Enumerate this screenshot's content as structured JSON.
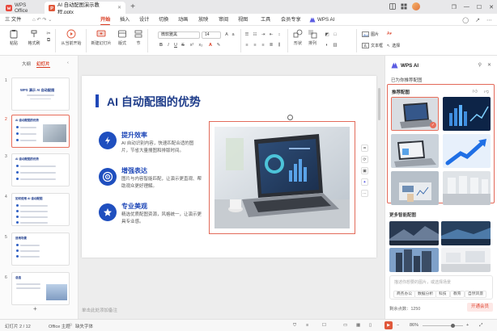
{
  "titlebar": {
    "tabs": [
      {
        "label": "WPS Office"
      },
      {
        "label": "AI 自动配图演示教程.pptx"
      }
    ],
    "colors": {
      "brand": "#d9381e",
      "wps": "#e8463a",
      "ppt": "#e0583b"
    }
  },
  "menubar": {
    "file_label": "三 文件",
    "items": [
      "开始",
      "插入",
      "设计",
      "切换",
      "动画",
      "放映",
      "审阅",
      "视图",
      "工具",
      "会员专享"
    ],
    "wps_ai": "WPS AI",
    "active_index": 0
  },
  "ribbon": {
    "paste": "粘贴",
    "format_painter": "格式刷",
    "from_current": "从当前开始",
    "new_slide": "新建幻灯片",
    "layout": "版式",
    "section": "节",
    "font_name": "微软雅黑",
    "font_size": "14",
    "shape": "形状",
    "arrange": "排列",
    "picture": "图片",
    "textbox": "文本框",
    "select": "选择"
  },
  "leftpanel": {
    "tabs": [
      "大纲",
      "幻灯片"
    ],
    "active_tab": 1,
    "slides": [
      {
        "num": "1",
        "title": "WPS 演示 AI 自动配图"
      },
      {
        "num": "2",
        "title": "AI 自动配图的优势"
      },
      {
        "num": "3",
        "title": "AI 自动配图的优势"
      },
      {
        "num": "4",
        "title": "如何使用 AI 自动配图"
      },
      {
        "num": "5",
        "title": "适用场景"
      },
      {
        "num": "6",
        "title": "总结"
      }
    ],
    "add_symbol": "+"
  },
  "slide": {
    "title": "AI 自动配图的优势",
    "features": [
      {
        "title": "提升效率",
        "desc": "AI 自动识别内容，快速匹配合适的图片，节省大量搜图和排版时间。"
      },
      {
        "title": "增强表达",
        "desc": "图片与内容智能匹配，让演示更直观、帮助观众更好理解。"
      },
      {
        "title": "专业美观",
        "desc": "精选优质配图资源，风格统一，让演示更具专业感。"
      }
    ],
    "accent": "#1f48b8"
  },
  "notes_placeholder": "单击此处添加备注",
  "ai_panel": {
    "title": "WPS AI",
    "subtitle": "已为你推荐配图",
    "rec_title": "推荐配图",
    "more_title": "更多智能配图",
    "prompt_placeholder": "描述你想要的图片，或选择场景",
    "chips": [
      "商务办公",
      "数据分析",
      "科技",
      "教育",
      "自然风景"
    ],
    "points": "剩余点数：1250",
    "generate": "开通会员"
  },
  "statusbar": {
    "slide_count": "幻灯片 2 / 12",
    "theme": "Office 主题",
    "missing_font": "缺失字体",
    "zoom": "86%"
  }
}
